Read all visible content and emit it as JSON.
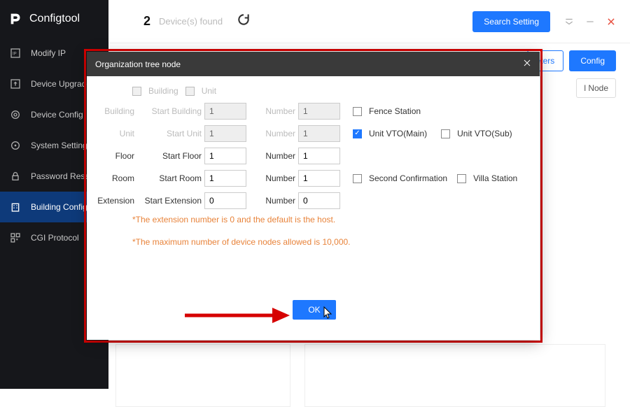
{
  "brand": "Configtool",
  "topbar": {
    "count": "2",
    "found_text": "Device(s) found",
    "search_setting": "Search Setting"
  },
  "sidebar": {
    "items": [
      {
        "label": "Modify IP"
      },
      {
        "label": "Device Upgrade"
      },
      {
        "label": "Device Config"
      },
      {
        "label": "System Settings"
      },
      {
        "label": "Password Reset"
      },
      {
        "label": "Building Config"
      },
      {
        "label": "CGI Protocol"
      }
    ]
  },
  "right_buttons": {
    "parameters": "eters",
    "config": "Config",
    "node_chip": "l Node"
  },
  "modal": {
    "title": "Organization tree node",
    "top": {
      "building": "Building",
      "unit": "Unit"
    },
    "rows": {
      "building": {
        "main": "Building",
        "sub": "Start Building",
        "start": "1",
        "numlbl": "Number",
        "num": "1"
      },
      "unit": {
        "main": "Unit",
        "sub": "Start Unit",
        "start": "1",
        "numlbl": "Number",
        "num": "1"
      },
      "floor": {
        "main": "Floor",
        "sub": "Start Floor",
        "start": "1",
        "numlbl": "Number",
        "num": "1"
      },
      "room": {
        "main": "Room",
        "sub": "Start Room",
        "start": "1",
        "numlbl": "Number",
        "num": "1"
      },
      "ext": {
        "main": "Extension",
        "sub": "Start Extension",
        "start": "0",
        "numlbl": "Number",
        "num": "0"
      }
    },
    "checks": {
      "fence": "Fence Station",
      "vto_main": "Unit VTO(Main)",
      "vto_sub": "Unit VTO(Sub)",
      "second": "Second Confirmation",
      "villa": "Villa Station"
    },
    "note1": "*The extension number is 0 and the default is the host.",
    "note2": "*The maximum number of device nodes allowed is 10,000.",
    "ok": "OK"
  }
}
